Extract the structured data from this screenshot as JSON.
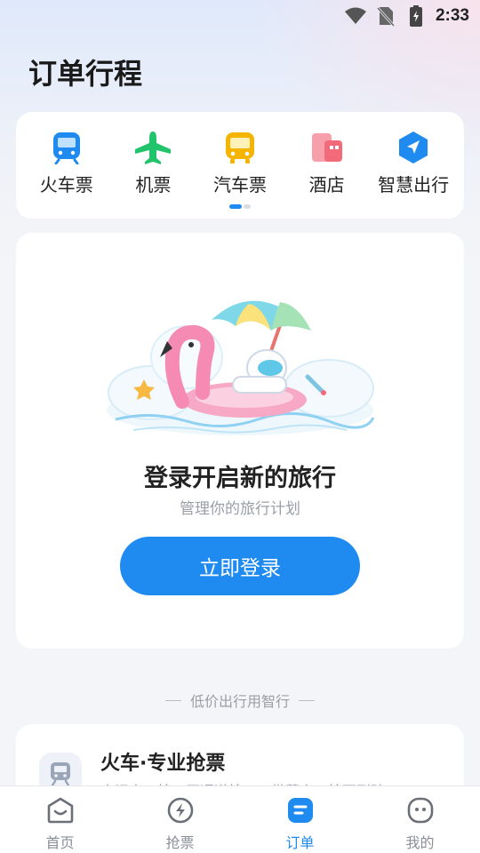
{
  "status_bar": {
    "time": "2:33",
    "icons": [
      "wifi-icon",
      "no-sim-icon",
      "battery-icon"
    ]
  },
  "header": {
    "title": "订单行程"
  },
  "categories": [
    {
      "label": "火车票",
      "icon": "train-icon",
      "color": "#1f8bf0"
    },
    {
      "label": "机票",
      "icon": "plane-icon",
      "color": "#21c36b"
    },
    {
      "label": "汽车票",
      "icon": "bus-icon",
      "color": "#f5b400"
    },
    {
      "label": "酒店",
      "icon": "hotel-icon",
      "color": "#f36b7a"
    },
    {
      "label": "智慧出行",
      "icon": "navigation-icon",
      "color": "#1f8bf0"
    }
  ],
  "login": {
    "title": "登录开启新的旅行",
    "subtitle": "管理你的旅行计划",
    "button": "立即登录"
  },
  "section": {
    "label": "低价出行用智行"
  },
  "promo": {
    "title": "火车·专业抢票",
    "description": "官记人工抢，买通道抢，一带荐出，抢不到赔"
  },
  "tabs": [
    {
      "label": "首页",
      "icon": "home-icon",
      "active": false
    },
    {
      "label": "抢票",
      "icon": "grab-ticket-icon",
      "active": false
    },
    {
      "label": "订单",
      "icon": "order-icon",
      "active": true
    },
    {
      "label": "我的",
      "icon": "profile-icon",
      "active": false
    }
  ],
  "colors": {
    "accent": "#1f8bf0",
    "background": "#f4f5f8"
  }
}
